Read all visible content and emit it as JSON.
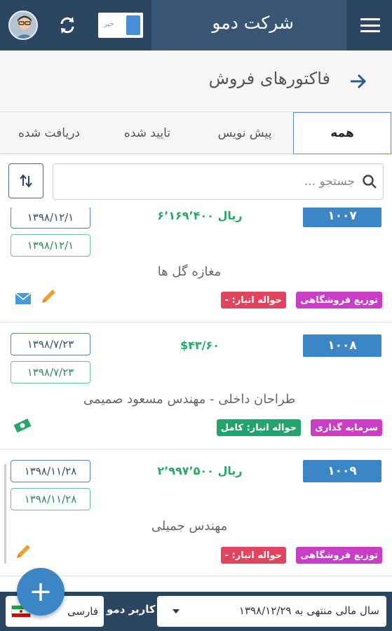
{
  "header": {
    "company_title": "شرکت دمو",
    "toggle_label": "خیر"
  },
  "page": {
    "title": "فاکتورهای فروش"
  },
  "tabs": [
    {
      "label": "همه",
      "active": true
    },
    {
      "label": "پیش نویس",
      "active": false
    },
    {
      "label": "تایید شده",
      "active": false
    },
    {
      "label": "دریافت شده",
      "active": false
    }
  ],
  "search": {
    "placeholder": "جستجو ..."
  },
  "invoices": [
    {
      "number": "۱۰۰۷",
      "amount": "ریال ۶٬۱۶۹٬۴۰۰",
      "date1": "۱۳۹۸/۱۲/۱",
      "date2": "۱۳۹۸/۱۲/۱",
      "customer": "مغازه گل ها",
      "tag1": "توزیع فروشگاهی",
      "tag2": "حواله انبار: -",
      "tag2_color": "#e2435d",
      "actions": [
        "mail-icon",
        "pencil-icon"
      ]
    },
    {
      "number": "۱۰۰۸",
      "amount": "$۴۳/۶۰",
      "date1": "۱۳۹۸/۷/۲۳",
      "date2": "۱۳۹۸/۷/۲۳",
      "customer": "طراحان داخلی - مهندس مسعود صمیمی",
      "tag1": "سرمایه گذاری",
      "tag2": "حواله انبار: کامل",
      "tag2_color": "#24a36e",
      "actions": [
        "money-icon"
      ]
    },
    {
      "number": "۱۰۰۹",
      "amount": "ریال ۲٬۹۹۷٬۵۰۰",
      "date1": "۱۳۹۸/۱۱/۲۸",
      "date2": "۱۳۹۸/۱۱/۲۸",
      "customer": "مهندس جمیلی",
      "tag1": "توزیع فروشگاهی",
      "tag2": "حواله انبار: -",
      "tag2_color": "#e2435d",
      "actions": [
        "pencil-icon"
      ]
    }
  ],
  "footer": {
    "fiscal_year": "سال مالی منتهی به ۱۳۹۸/۱۲/۲۹",
    "user_label": "کاربر دمو",
    "language": "فارسی"
  },
  "fab": {
    "label": "+"
  },
  "colors": {
    "primary": "#2c4561",
    "accent": "#3d86c6",
    "amount_green": "#2ba66b",
    "tag_purple": "#c83fc6"
  }
}
